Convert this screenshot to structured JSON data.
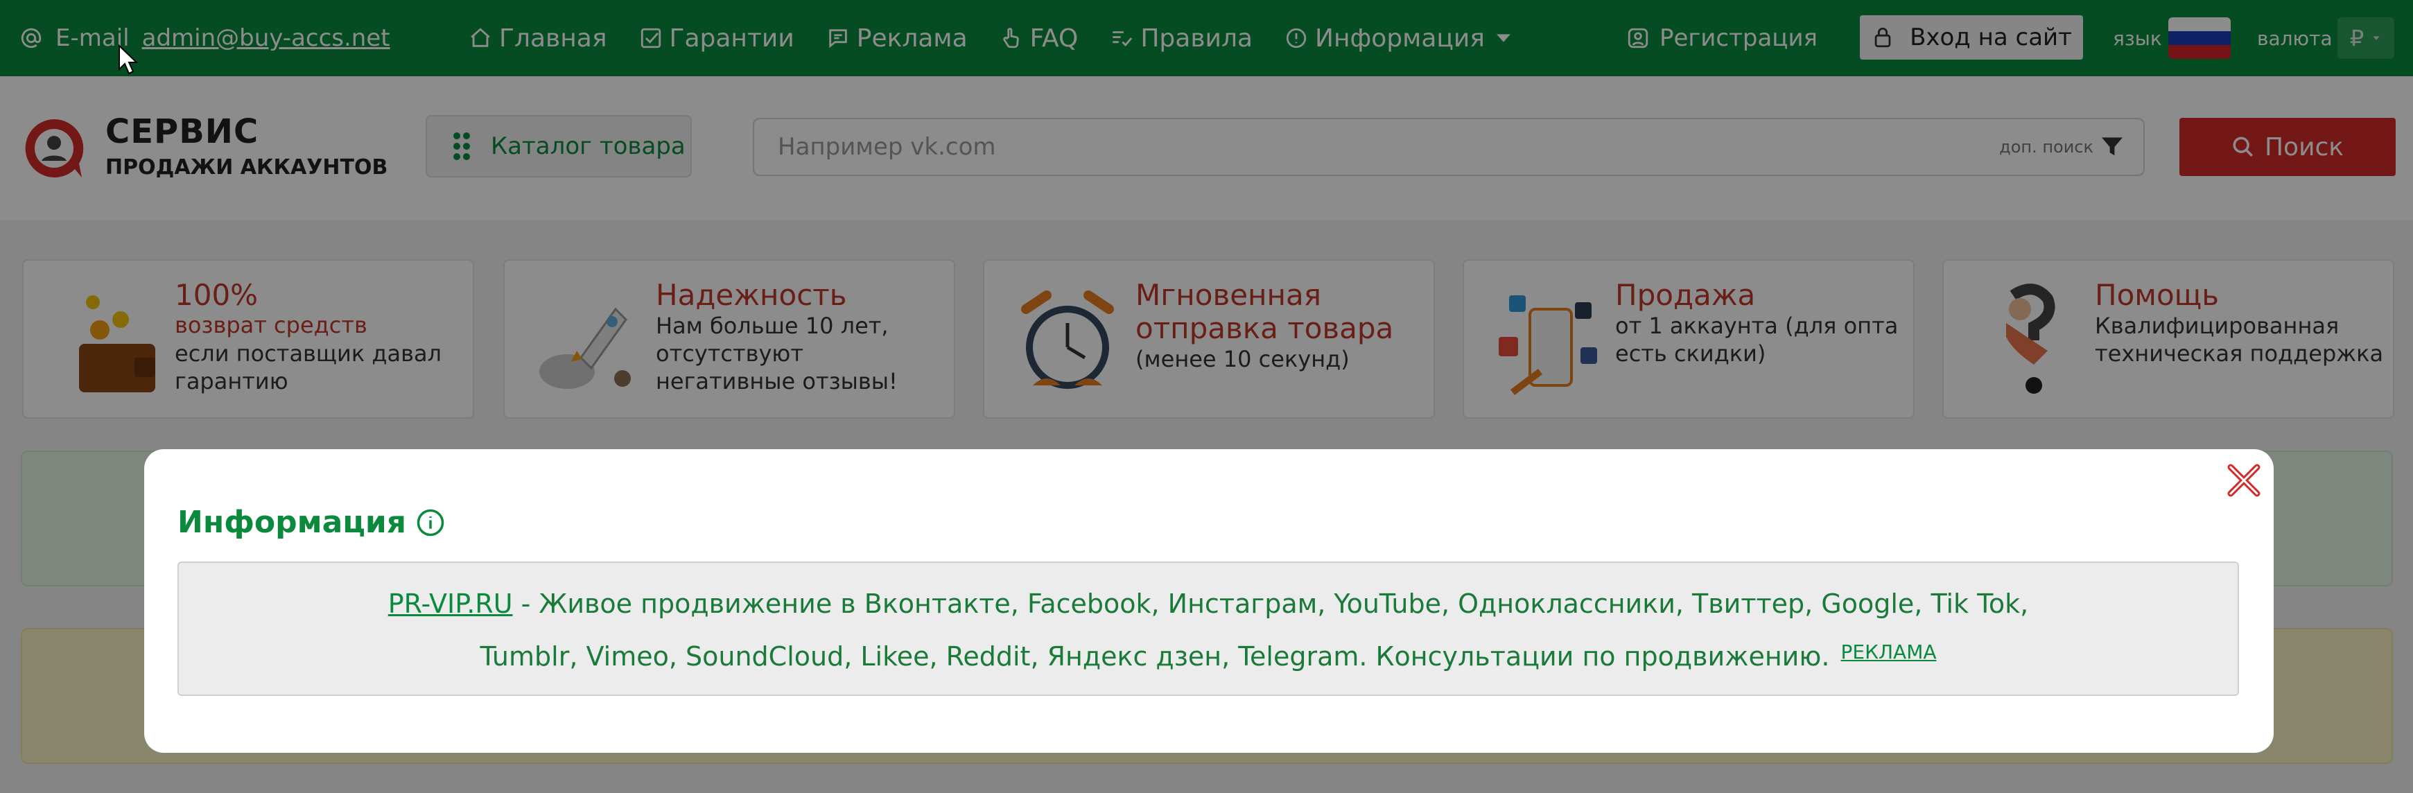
{
  "topbar": {
    "email_label": "E-mail",
    "email_address": "admin@buy-accs.net",
    "nav": [
      {
        "label": "Главная",
        "icon": "home-icon"
      },
      {
        "label": "Гарантии",
        "icon": "checkbox-icon"
      },
      {
        "label": "Реклама",
        "icon": "chat-icon"
      },
      {
        "label": "FAQ",
        "icon": "hand-pointer-icon"
      },
      {
        "label": "Правила",
        "icon": "list-check-icon"
      },
      {
        "label": "Информация",
        "icon": "info-icon"
      }
    ],
    "register_label": "Регистрация",
    "login_label": "Вход на сайт",
    "language_label": "язык",
    "currency_label": "валюта",
    "currency_symbol": "₽"
  },
  "header": {
    "brand_title": "СЕРВИС",
    "brand_subtitle": "ПРОДАЖИ АККАУНТОВ",
    "catalog_label": "Каталог товара",
    "search_placeholder": "Например vk.com",
    "extra_search_label": "доп. поиск",
    "search_button_label": "Поиск"
  },
  "features": [
    {
      "title": "100%",
      "highlight": "возврат средств",
      "text": "если поставщик давал гарантию"
    },
    {
      "title": "Надежность",
      "text": "Нам больше 10 лет, отсутствуют негативные отзывы!"
    },
    {
      "title": "Мгновенная отправка товара",
      "text": "(менее 10 секунд)"
    },
    {
      "title": "Продажа",
      "text": "от 1 аккаунта (для опта есть скидки)"
    },
    {
      "title": "Помощь",
      "text": "Квалифицированная техническая поддержка"
    }
  ],
  "modal": {
    "title": "Информация",
    "link_text": "PR-VIP.RU",
    "line1": " - Живое продвижение в Вконтакте, Facebook, Инстаграм, YouTube, Одноклассники, Твиттер, Google, Tik Tok,",
    "line2": "Tumblr, Vimeo, SoundCloud, Likee, Reddit, Яндекс дзен, Telegram. Консультации по продвижению.",
    "ad_label": "РЕКЛАМА"
  },
  "colors": {
    "brand_green": "#0b8a3e",
    "accent_red": "#d22b2b",
    "card_title_red": "#c0392b"
  }
}
